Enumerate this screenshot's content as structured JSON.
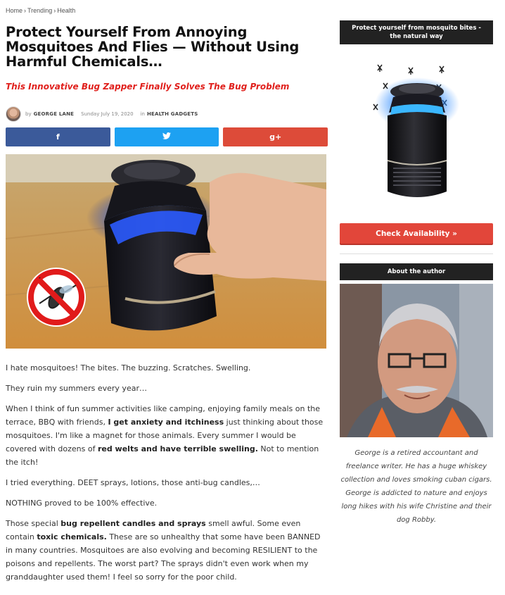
{
  "breadcrumb": {
    "items": [
      "Home",
      "Trending",
      "Health"
    ],
    "separator": "›"
  },
  "article": {
    "title": "Protect Yourself From Annoying Mosquitoes And Flies — Without Using Harmful Chemicals…",
    "subtitle": "This Innovative Bug Zapper Finally Solves The Bug Problem",
    "byline": {
      "by": "by",
      "author": "GEORGE LANE",
      "date": "Sunday July 19, 2020",
      "in": "in",
      "category": "HEALTH GADGETS"
    },
    "share": {
      "facebook": "f",
      "twitter": "🐦",
      "googleplus": "g+"
    },
    "paragraphs": {
      "p1": "I hate mosquitoes! The bites. The buzzing. Scratches. Swelling.",
      "p2": "They ruin my summers every year…",
      "p3a": "When I think of fun summer activities like camping, enjoying family meals on the terrace, BBQ with friends, ",
      "p3b": "I get anxiety and itchiness",
      "p3c": " just thinking about those mosquitoes. I'm like a magnet for those animals. Every summer I would be covered with dozens of ",
      "p3d": "red welts and have terrible swelling.",
      "p3e": " Not to mention the itch!",
      "p4": "I tried everything. DEET sprays, lotions, those anti-bug candles,…",
      "p5": "NOTHING proved to be 100% effective.",
      "p6a": "Those special ",
      "p6b": "bug repellent candles and sprays",
      "p6c": " smell awful. Some even contain ",
      "p6d": "toxic chemicals.",
      "p6e": " These are so unhealthy that some have been BANNED in many countries. Mosquitoes are also evolving and becoming RESILIENT to the poisons and repellents. The worst part? The sprays didn't even work when my granddaughter used them! I feel so sorry for the poor child."
    }
  },
  "sidebar": {
    "promo_heading": "Protect yourself from mosquito bites - the natural way",
    "cta_label": "Check Availability »",
    "about_heading": "About the author",
    "bio": "George is a retired accountant and freelance writer. He has a huge whiskey collection and loves smoking cuban cigars. George is addicted to nature and enjoys long hikes with his wife Christine and their dog Robby."
  },
  "colors": {
    "accent_red": "#e0201c",
    "facebook": "#3b5a9a",
    "twitter": "#1da1f2",
    "googleplus": "#dd4b39",
    "cta": "#e2463a"
  },
  "icons": [
    "facebook-icon",
    "twitter-icon",
    "google-plus-icon",
    "no-mosquito-icon",
    "mosquito-icon"
  ]
}
